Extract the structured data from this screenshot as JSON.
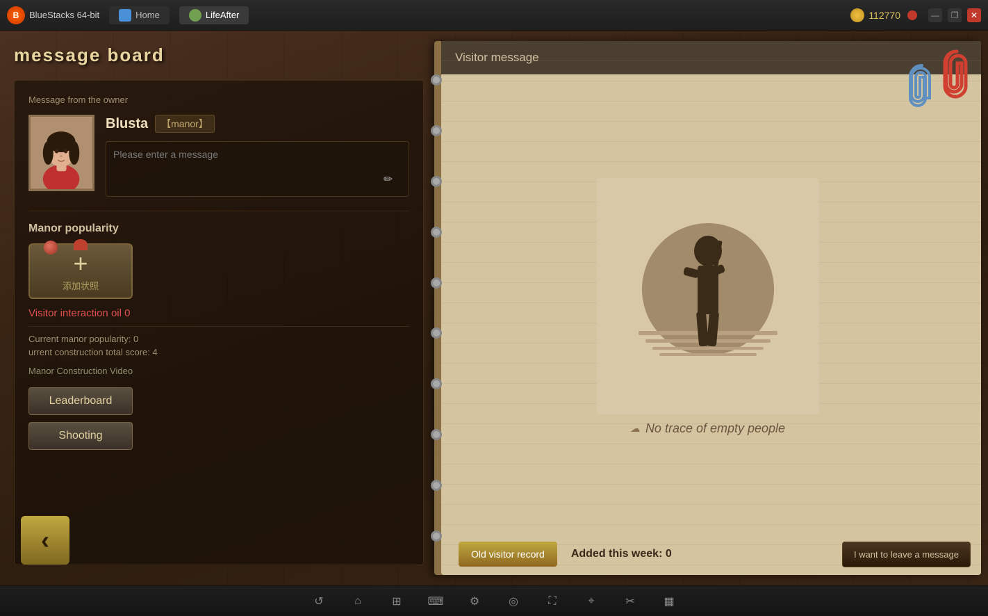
{
  "titlebar": {
    "app_name": "BlueStacks 64-bit",
    "home_tab": "Home",
    "game_tab": "LifeAfter",
    "coins": "112770",
    "close_label": "✕",
    "minimize_label": "—",
    "restore_label": "❐"
  },
  "message_board": {
    "title": "message board",
    "owner_label": "Message from the owner",
    "owner_name": "Blusta",
    "owner_tag": "【manor】",
    "message_placeholder": "Please enter a message",
    "popularity_label": "Manor popularity",
    "add_photo_text": "添加状照",
    "visitor_oil_text": "Visitor interaction oil 0",
    "current_popularity": "Current manor popularity: 0",
    "construction_score": "urrent construction total score: 4",
    "construction_video": "Manor Construction Video",
    "leaderboard_btn": "Leaderboard",
    "shooting_btn": "Shooting"
  },
  "visitor_panel": {
    "header": "Visitor message",
    "no_trace_text": "No trace of empty people",
    "old_record_btn": "Old visitor record",
    "added_week": "Added this week: 0",
    "leave_message_btn": "I want to leave a message"
  },
  "taskbar": {
    "back_icon": "↺",
    "home_icon": "⌂",
    "apps_icon": "⊞",
    "keyboard_icon": "⌨",
    "settings_icon": "⚙",
    "camera_icon": "◎",
    "fullscreen_icon": "⛶",
    "location_icon": "⌖",
    "scissors_icon": "✂",
    "grid_icon": "▦"
  },
  "colors": {
    "wood_dark": "#3d2b1a",
    "gold": "#e0c060",
    "red_accent": "#e05050",
    "paper_bg": "#d4c4a0"
  }
}
